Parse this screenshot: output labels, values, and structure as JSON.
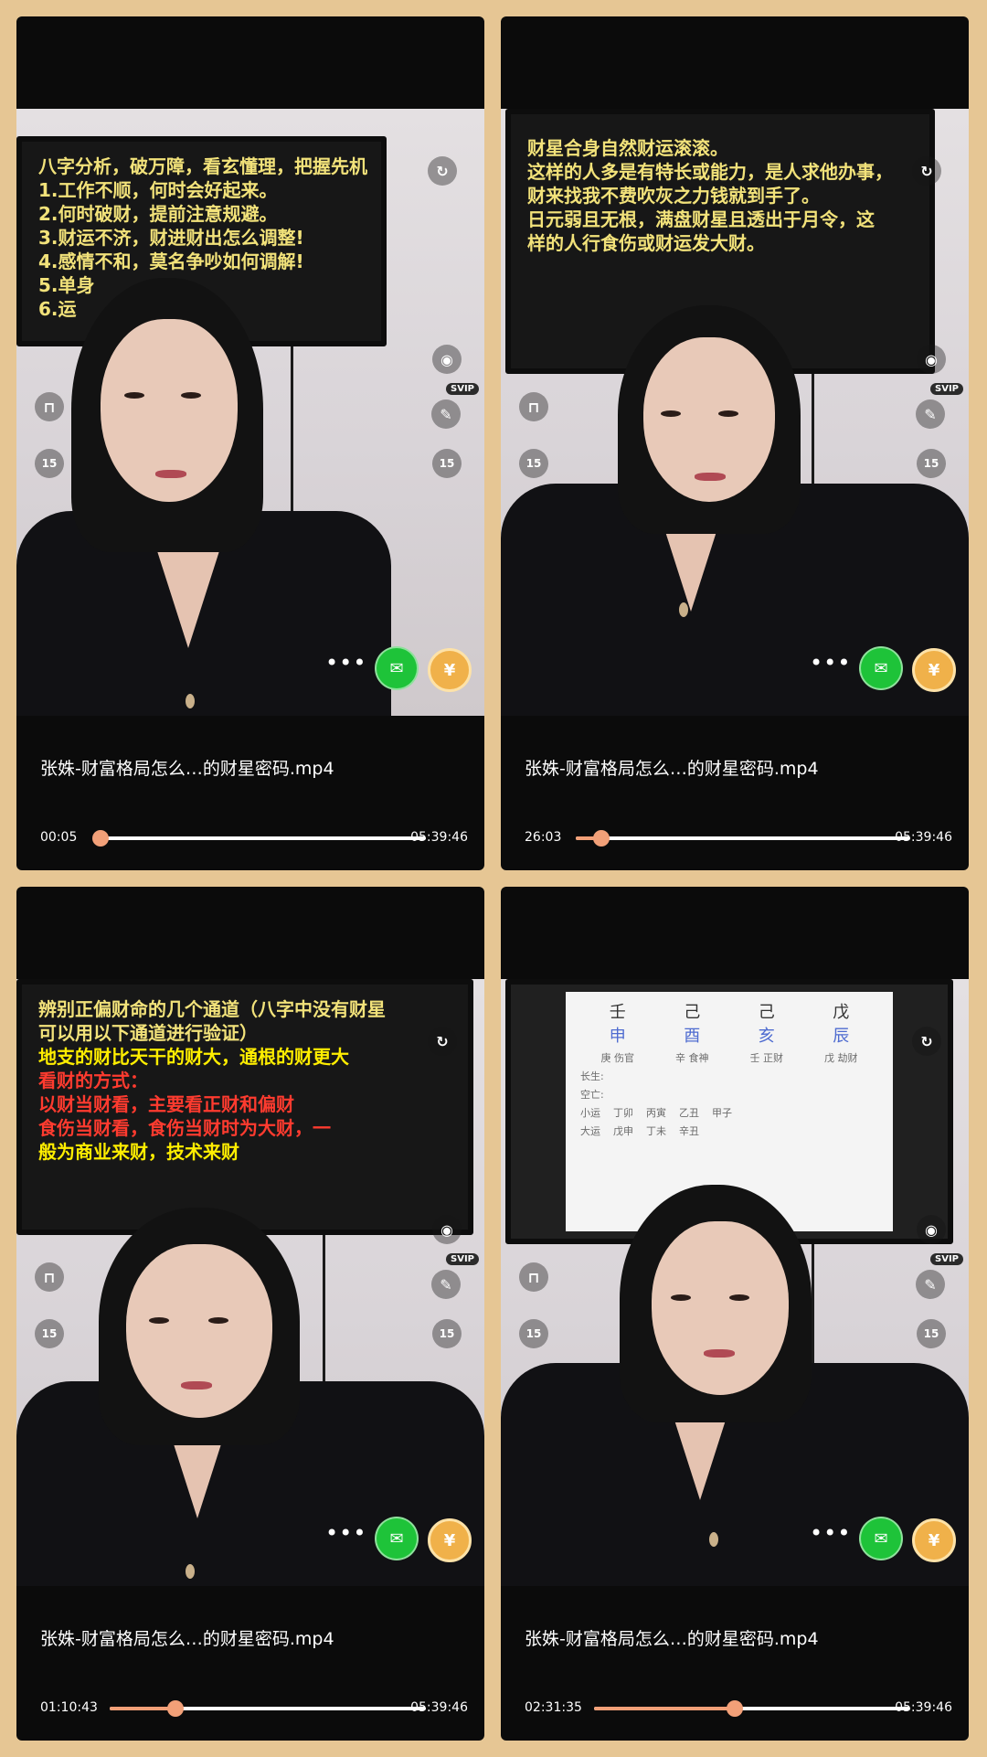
{
  "colors": {
    "progress_accent": "#f2a078",
    "wechat_green": "#1ec339",
    "coin_gold": "#f0b14a",
    "page_bg": "#e6c694"
  },
  "icons": {
    "share": "share-icon",
    "camera": "camera-icon",
    "lock": "unlock-icon",
    "pin": "pin-icon",
    "rewind": "rewind-15-icon",
    "forward": "forward-15-icon",
    "more": "more-icon",
    "wechat": "wechat-icon",
    "coin": "coin-icon"
  },
  "overlay": {
    "svip_badge": "SVIP",
    "rewind_label": "15",
    "forward_label": "15",
    "more_label": "•••",
    "coin_label": "¥"
  },
  "cards": [
    {
      "title": "张姝-财富格局怎么…的财星密码.mp4",
      "current_time": "00:05",
      "duration": "05:39:46",
      "progress": 0.0003,
      "monitor_lines": [
        "八字分析，破万障，看玄懂理，把握先机",
        "1.工作不顺，何时会好起来。",
        "2.何时破财，提前注意规避。",
        "3.财运不济，财进财出怎么调整!",
        "4.感情不和，莫名争吵如何调解!",
        "5.单身",
        "6.运"
      ]
    },
    {
      "title": "张姝-财富格局怎么…的财星密码.mp4",
      "current_time": "26:03",
      "duration": "05:39:46",
      "progress": 0.077,
      "monitor_lines": [
        "财星合身自然财运滚滚。",
        "这样的人多是有特长或能力，是人求他办事，",
        "财来找我不费吹灰之力钱就到手了。",
        "日元弱且无根，满盘财星且透出于月令，这",
        "样的人行食伤或财运发大财。"
      ]
    },
    {
      "title": "张姝-财富格局怎么…的财星密码.mp4",
      "current_time": "01:10:43",
      "duration": "05:39:46",
      "progress": 0.208,
      "monitor_lines": [
        "辨别正偏财命的几个通道（八字中没有财星",
        "可以用以下通道进行验证）",
        "地支的财比天干的财大，通根的财更大",
        "看财的方式：",
        "以财当财看，主要看正财和偏财",
        "食伤当财看，食伤当财时为大财，一",
        "般为商业来财，技术来财"
      ]
    },
    {
      "title": "张姝-财富格局怎么…的财星密码.mp4",
      "current_time": "02:31:35",
      "duration": "05:39:46",
      "progress": 0.446,
      "chart_sheet": {
        "stems": [
          "壬",
          "己",
          "己",
          "戊"
        ],
        "branches": [
          "申",
          "酉",
          "亥",
          "辰"
        ],
        "hidden": [
          "庚 伤官",
          "辛 食神",
          "壬 正财",
          "戊 劫财"
        ],
        "row_labels": [
          "长生:",
          "空亡:",
          "小运",
          "大运"
        ],
        "small_years": [
          "丁卯",
          "丙寅",
          "乙丑",
          "甲子"
        ],
        "dayun": [
          "戊申",
          "丁未",
          "辛丑"
        ]
      }
    }
  ]
}
